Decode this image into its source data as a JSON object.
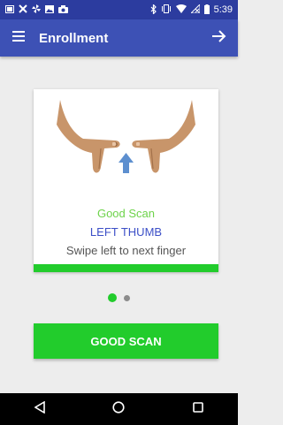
{
  "status_bar": {
    "time": "5:39",
    "left_icons": [
      "gallery-icon",
      "tools-icon",
      "fan-icon",
      "image-icon",
      "camera-icon"
    ],
    "right_icons": [
      "bluetooth-icon",
      "vibrate-icon",
      "wifi-icon",
      "no-signal-icon",
      "battery-icon"
    ]
  },
  "app_bar": {
    "title": "Enrollment",
    "menu_icon": "hamburger-menu-icon",
    "forward_icon": "arrow-right-icon"
  },
  "scan_card": {
    "status": "Good Scan",
    "finger": "LEFT THUMB",
    "instruction": "Swipe left to next finger",
    "progress": 1.0
  },
  "pager": {
    "pages": 2,
    "active_index": 0
  },
  "action": {
    "button_label": "GOOD SCAN"
  },
  "navigation_bar": {
    "buttons": [
      "back-icon",
      "home-icon",
      "recents-icon"
    ]
  },
  "colors": {
    "status_bar": "#2c3c9f",
    "app_bar": "#3d51b5",
    "accent_green": "#22cc2c",
    "status_text_green": "#6dd34a",
    "finger_text_blue": "#3c4fc7"
  }
}
